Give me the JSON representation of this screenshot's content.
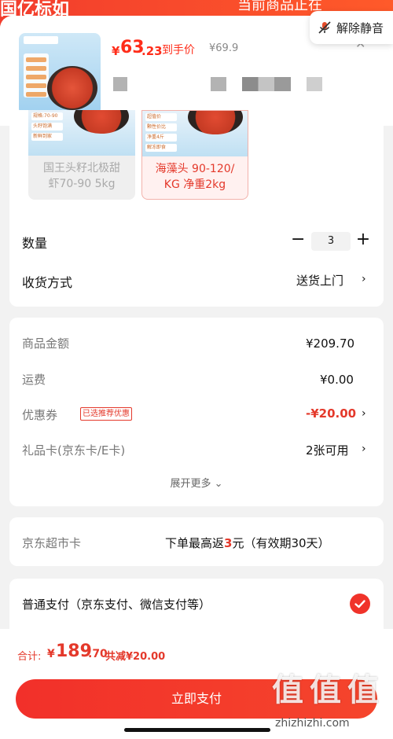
{
  "topbar": {
    "left_text": "国亿标如",
    "right_text": "当前商品正在"
  },
  "mute_button": {
    "label": "解除静音",
    "icon": "mic-off-icon"
  },
  "product": {
    "price_symbol": "¥",
    "price_int": "63",
    "price_dec": ".23",
    "price_label": "到手价",
    "original_price": "¥69.9",
    "close_icon": "close-icon"
  },
  "variants": [
    {
      "label_line1": "国王头籽北极甜",
      "label_line2": "虾70-90 5kg",
      "selected": false
    },
    {
      "label_line1": "海藻头 90-120/",
      "label_line2": "KG 净重2kg",
      "selected": true
    }
  ],
  "quantity": {
    "label": "数量",
    "minus": "−",
    "value": "3",
    "plus": "+"
  },
  "shipping": {
    "label": "收货方式",
    "value": "送货上门"
  },
  "fees": {
    "goods_label": "商品金额",
    "goods_value": "¥209.70",
    "freight_label": "运费",
    "freight_value": "¥0.00",
    "coupon_label": "优惠券",
    "coupon_tag": "已选推荐优惠",
    "coupon_value": "-¥20.00",
    "giftcard_label": "礼品卡(京东卡/E卡)",
    "giftcard_value": "2张可用",
    "expand_label": "展开更多"
  },
  "market_card": {
    "label": "京东超市卡",
    "value_prefix": "下单最高返",
    "value_amount": "3",
    "value_suffix": "元（有效期30天）"
  },
  "payment": {
    "label": "普通支付（京东支付、微信支付等）",
    "checked": true
  },
  "summary": {
    "total_label": "合计:",
    "total_symbol": "¥",
    "total_int": "189",
    "total_dec": ".70",
    "savings": "共减¥20.00"
  },
  "pay_button": {
    "label": "立即支付"
  },
  "watermark": {
    "text": "zhizhizhi.com",
    "mark": "值"
  },
  "colors": {
    "accent": "#f0332a",
    "price_red": "#ff2d1a"
  }
}
